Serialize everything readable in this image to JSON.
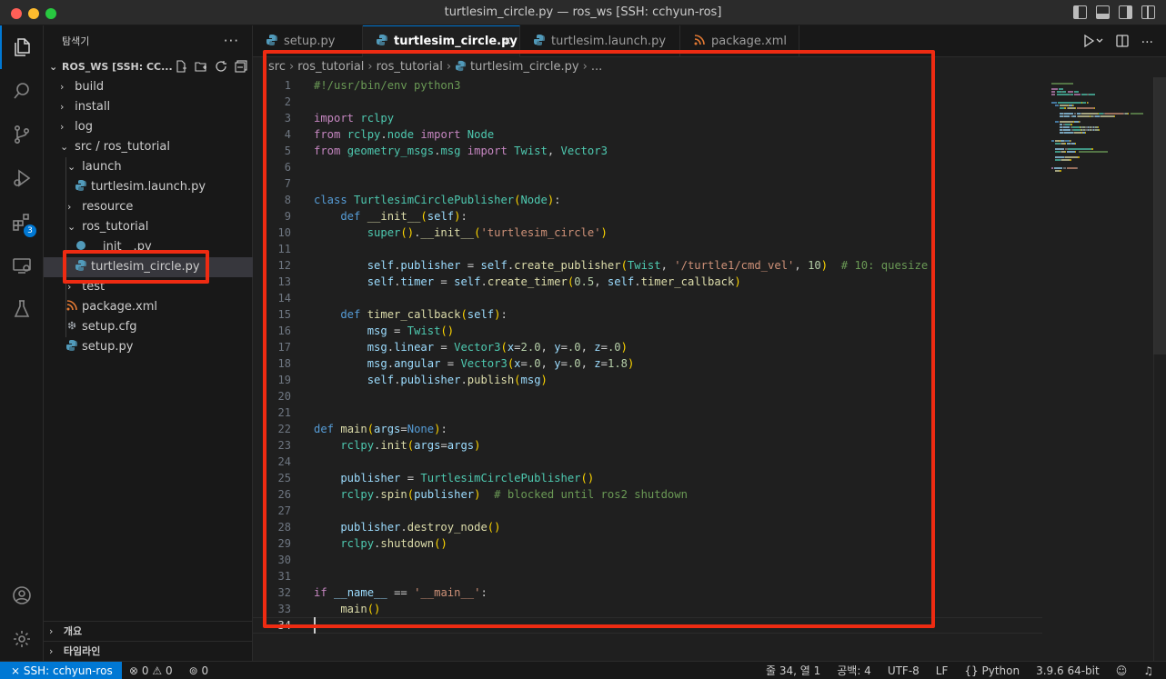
{
  "window": {
    "title": "turtlesim_circle.py — ros_ws [SSH: cchyun-ros]"
  },
  "sidebar": {
    "header": "탐색기",
    "more": "···",
    "workspace": "ROS_WS [SSH: CC...",
    "items": [
      {
        "label": "build"
      },
      {
        "label": "install"
      },
      {
        "label": "log"
      },
      {
        "label": "src / ros_tutorial"
      },
      {
        "label": "launch"
      },
      {
        "label": "turtlesim.launch.py"
      },
      {
        "label": "resource"
      },
      {
        "label": "ros_tutorial"
      },
      {
        "label": "__init__.py"
      },
      {
        "label": "turtlesim_circle.py"
      },
      {
        "label": "test"
      },
      {
        "label": "package.xml"
      },
      {
        "label": "setup.cfg"
      },
      {
        "label": "setup.py"
      }
    ],
    "outline": "개요",
    "timeline": "타임라인"
  },
  "activity": {
    "extensions_badge": "3"
  },
  "tabs": [
    {
      "label": "setup.py"
    },
    {
      "label": "turtlesim_circle.py"
    },
    {
      "label": "turtlesim.launch.py"
    },
    {
      "label": "package.xml"
    }
  ],
  "tab_close": "×",
  "breadcrumb": {
    "p1": "src",
    "p2": "ros_tutorial",
    "p3": "ros_tutorial",
    "p4": "turtlesim_circle.py",
    "p5": "..."
  },
  "editor": {
    "line_numbers": [
      "1",
      "2",
      "3",
      "4",
      "5",
      "6",
      "7",
      "8",
      "9",
      "10",
      "11",
      "12",
      "13",
      "14",
      "15",
      "16",
      "17",
      "18",
      "19",
      "20",
      "21",
      "22",
      "23",
      "24",
      "25",
      "26",
      "27",
      "28",
      "29",
      "30",
      "31",
      "32",
      "33",
      "34"
    ],
    "lines": [
      [
        {
          "t": "#!/usr/bin/env python3",
          "c": "cm"
        }
      ],
      [],
      [
        {
          "t": "import",
          "c": "kw"
        },
        {
          "t": " rclpy",
          "c": "cls"
        }
      ],
      [
        {
          "t": "from",
          "c": "kw"
        },
        {
          "t": " rclpy",
          "c": "cls"
        },
        {
          "t": ".",
          "c": ""
        },
        {
          "t": "node",
          "c": "cls"
        },
        {
          "t": " import",
          "c": "kw"
        },
        {
          "t": " Node",
          "c": "cls"
        }
      ],
      [
        {
          "t": "from",
          "c": "kw"
        },
        {
          "t": " geometry_msgs",
          "c": "cls"
        },
        {
          "t": ".",
          "c": ""
        },
        {
          "t": "msg",
          "c": "cls"
        },
        {
          "t": " import",
          "c": "kw"
        },
        {
          "t": " Twist",
          "c": "cls"
        },
        {
          "t": ", ",
          "c": ""
        },
        {
          "t": "Vector3",
          "c": "cls"
        }
      ],
      [],
      [],
      [
        {
          "t": "class",
          "c": "kb"
        },
        {
          "t": " TurtlesimCirclePublisher",
          "c": "cls"
        },
        {
          "t": "(",
          "c": "p1"
        },
        {
          "t": "Node",
          "c": "cls"
        },
        {
          "t": ")",
          "c": "p1"
        },
        {
          "t": ":",
          "c": ""
        }
      ],
      [
        {
          "t": "    def",
          "c": "kb"
        },
        {
          "t": " __init__",
          "c": "fn"
        },
        {
          "t": "(",
          "c": "p1"
        },
        {
          "t": "self",
          "c": "var"
        },
        {
          "t": ")",
          "c": "p1"
        },
        {
          "t": ":",
          "c": ""
        }
      ],
      [
        {
          "t": "        super",
          "c": "cls"
        },
        {
          "t": "(",
          "c": "p1"
        },
        {
          "t": ")",
          "c": "p1"
        },
        {
          "t": ".",
          "c": ""
        },
        {
          "t": "__init__",
          "c": "fn"
        },
        {
          "t": "(",
          "c": "p1"
        },
        {
          "t": "'turtlesim_circle'",
          "c": "str"
        },
        {
          "t": ")",
          "c": "p1"
        }
      ],
      [],
      [
        {
          "t": "        self",
          "c": "var"
        },
        {
          "t": ".",
          "c": ""
        },
        {
          "t": "publisher",
          "c": "var"
        },
        {
          "t": " = ",
          "c": ""
        },
        {
          "t": "self",
          "c": "var"
        },
        {
          "t": ".",
          "c": ""
        },
        {
          "t": "create_publisher",
          "c": "fn"
        },
        {
          "t": "(",
          "c": "p1"
        },
        {
          "t": "Twist",
          "c": "cls"
        },
        {
          "t": ", ",
          "c": ""
        },
        {
          "t": "'/turtle1/cmd_vel'",
          "c": "str"
        },
        {
          "t": ", ",
          "c": ""
        },
        {
          "t": "10",
          "c": "num"
        },
        {
          "t": ")",
          "c": "p1"
        },
        {
          "t": "  # 10: quesize",
          "c": "cm"
        }
      ],
      [
        {
          "t": "        self",
          "c": "var"
        },
        {
          "t": ".",
          "c": ""
        },
        {
          "t": "timer",
          "c": "var"
        },
        {
          "t": " = ",
          "c": ""
        },
        {
          "t": "self",
          "c": "var"
        },
        {
          "t": ".",
          "c": ""
        },
        {
          "t": "create_timer",
          "c": "fn"
        },
        {
          "t": "(",
          "c": "p1"
        },
        {
          "t": "0.5",
          "c": "num"
        },
        {
          "t": ", ",
          "c": ""
        },
        {
          "t": "self",
          "c": "var"
        },
        {
          "t": ".",
          "c": ""
        },
        {
          "t": "timer_callback",
          "c": "fn"
        },
        {
          "t": ")",
          "c": "p1"
        }
      ],
      [],
      [
        {
          "t": "    def",
          "c": "kb"
        },
        {
          "t": " timer_callback",
          "c": "fn"
        },
        {
          "t": "(",
          "c": "p1"
        },
        {
          "t": "self",
          "c": "var"
        },
        {
          "t": ")",
          "c": "p1"
        },
        {
          "t": ":",
          "c": ""
        }
      ],
      [
        {
          "t": "        msg",
          "c": "var"
        },
        {
          "t": " = ",
          "c": ""
        },
        {
          "t": "Twist",
          "c": "cls"
        },
        {
          "t": "(",
          "c": "p1"
        },
        {
          "t": ")",
          "c": "p1"
        }
      ],
      [
        {
          "t": "        msg",
          "c": "var"
        },
        {
          "t": ".",
          "c": ""
        },
        {
          "t": "linear",
          "c": "var"
        },
        {
          "t": " = ",
          "c": ""
        },
        {
          "t": "Vector3",
          "c": "cls"
        },
        {
          "t": "(",
          "c": "p1"
        },
        {
          "t": "x",
          "c": "var"
        },
        {
          "t": "=",
          "c": ""
        },
        {
          "t": "2.0",
          "c": "num"
        },
        {
          "t": ", ",
          "c": ""
        },
        {
          "t": "y",
          "c": "var"
        },
        {
          "t": "=",
          "c": ""
        },
        {
          "t": ".0",
          "c": "num"
        },
        {
          "t": ", ",
          "c": ""
        },
        {
          "t": "z",
          "c": "var"
        },
        {
          "t": "=",
          "c": ""
        },
        {
          "t": ".0",
          "c": "num"
        },
        {
          "t": ")",
          "c": "p1"
        }
      ],
      [
        {
          "t": "        msg",
          "c": "var"
        },
        {
          "t": ".",
          "c": ""
        },
        {
          "t": "angular",
          "c": "var"
        },
        {
          "t": " = ",
          "c": ""
        },
        {
          "t": "Vector3",
          "c": "cls"
        },
        {
          "t": "(",
          "c": "p1"
        },
        {
          "t": "x",
          "c": "var"
        },
        {
          "t": "=",
          "c": ""
        },
        {
          "t": ".0",
          "c": "num"
        },
        {
          "t": ", ",
          "c": ""
        },
        {
          "t": "y",
          "c": "var"
        },
        {
          "t": "=",
          "c": ""
        },
        {
          "t": ".0",
          "c": "num"
        },
        {
          "t": ", ",
          "c": ""
        },
        {
          "t": "z",
          "c": "var"
        },
        {
          "t": "=",
          "c": ""
        },
        {
          "t": "1.8",
          "c": "num"
        },
        {
          "t": ")",
          "c": "p1"
        }
      ],
      [
        {
          "t": "        self",
          "c": "var"
        },
        {
          "t": ".",
          "c": ""
        },
        {
          "t": "publisher",
          "c": "var"
        },
        {
          "t": ".",
          "c": ""
        },
        {
          "t": "publish",
          "c": "fn"
        },
        {
          "t": "(",
          "c": "p1"
        },
        {
          "t": "msg",
          "c": "var"
        },
        {
          "t": ")",
          "c": "p1"
        }
      ],
      [],
      [],
      [
        {
          "t": "def",
          "c": "kb"
        },
        {
          "t": " main",
          "c": "fn"
        },
        {
          "t": "(",
          "c": "p1"
        },
        {
          "t": "args",
          "c": "var"
        },
        {
          "t": "=",
          "c": ""
        },
        {
          "t": "None",
          "c": "kb"
        },
        {
          "t": ")",
          "c": "p1"
        },
        {
          "t": ":",
          "c": ""
        }
      ],
      [
        {
          "t": "    rclpy",
          "c": "cls"
        },
        {
          "t": ".",
          "c": ""
        },
        {
          "t": "init",
          "c": "fn"
        },
        {
          "t": "(",
          "c": "p1"
        },
        {
          "t": "args",
          "c": "var"
        },
        {
          "t": "=",
          "c": ""
        },
        {
          "t": "args",
          "c": "var"
        },
        {
          "t": ")",
          "c": "p1"
        }
      ],
      [],
      [
        {
          "t": "    publisher",
          "c": "var"
        },
        {
          "t": " = ",
          "c": ""
        },
        {
          "t": "TurtlesimCirclePublisher",
          "c": "cls"
        },
        {
          "t": "(",
          "c": "p1"
        },
        {
          "t": ")",
          "c": "p1"
        }
      ],
      [
        {
          "t": "    rclpy",
          "c": "cls"
        },
        {
          "t": ".",
          "c": ""
        },
        {
          "t": "spin",
          "c": "fn"
        },
        {
          "t": "(",
          "c": "p1"
        },
        {
          "t": "publisher",
          "c": "var"
        },
        {
          "t": ")",
          "c": "p1"
        },
        {
          "t": "  # blocked until ros2 shutdown",
          "c": "cm"
        }
      ],
      [],
      [
        {
          "t": "    publisher",
          "c": "var"
        },
        {
          "t": ".",
          "c": ""
        },
        {
          "t": "destroy_node",
          "c": "fn"
        },
        {
          "t": "(",
          "c": "p1"
        },
        {
          "t": ")",
          "c": "p1"
        }
      ],
      [
        {
          "t": "    rclpy",
          "c": "cls"
        },
        {
          "t": ".",
          "c": ""
        },
        {
          "t": "shutdown",
          "c": "fn"
        },
        {
          "t": "(",
          "c": "p1"
        },
        {
          "t": ")",
          "c": "p1"
        }
      ],
      [],
      [],
      [
        {
          "t": "if",
          "c": "kw"
        },
        {
          "t": " __name__",
          "c": "var"
        },
        {
          "t": " == ",
          "c": ""
        },
        {
          "t": "'__main__'",
          "c": "str"
        },
        {
          "t": ":",
          "c": ""
        }
      ],
      [
        {
          "t": "    main",
          "c": "fn"
        },
        {
          "t": "(",
          "c": "p1"
        },
        {
          "t": ")",
          "c": "p1"
        }
      ],
      []
    ]
  },
  "statusbar": {
    "remote": "SSH: cchyun-ros",
    "errors": "0",
    "warnings": "0",
    "ports": "0",
    "position": "줄 34, 열 1",
    "spaces": "공백: 4",
    "encoding": "UTF-8",
    "eol": "LF",
    "language": "Python",
    "interpreter": "3.9.6 64-bit"
  },
  "colors": {
    "accent": "#0078d4",
    "highlight": "#ee2b12",
    "python_icon": "#519aba",
    "xml_icon": "#e37933"
  }
}
